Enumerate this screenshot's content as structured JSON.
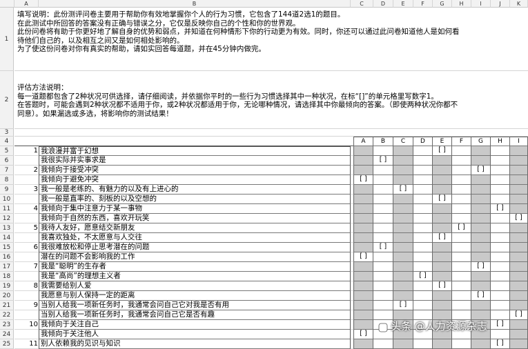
{
  "column_headers": [
    "A",
    "B",
    "C",
    "D",
    "E",
    "F",
    "G",
    "H",
    "I",
    "J",
    "K"
  ],
  "row_headers": [
    "1",
    "2",
    "3",
    "4",
    "5",
    "6",
    "7",
    "8",
    "9",
    "10",
    "11",
    "12",
    "13",
    "14",
    "15",
    "16",
    "17",
    "18",
    "19",
    "20",
    "21",
    "22",
    "23",
    "24",
    "25"
  ],
  "header_text": {
    "row1": [
      "填写说明：此份测评问卷主要用于帮助你有效地掌握你个人的行为习惯，它包含了144道2选1的题目。",
      "在此测试中所回答的答案没有正确与错误之分，它仅是反映你自己的个性和你的世界观。",
      "此份问卷将有助于你更好地了解自身的优势和弱点，并知道在何种情形下你的行动更为有效。同时，你还可以通过此问卷知道他人是如何看",
      "待他们自己的，以及相互之间又是如何相处影响的。",
      "为了使这份问卷对你有真实的帮助，请如实回答每道题，并在45分钟内做完。"
    ],
    "row2": [
      "评估方法说明：",
      "每一道题都包含了2种状况可供选择，请仔细阅读，并依据你平时的一些行为习惯选择其中一种状况，在标“[]”的单元格里写数字1。",
      "在答题时，可能会遇到2种状况都不适用于你，或2种状况都适用于你，无论哪种情况，请选择其中你最倾向的答案。（即使两种状况你都不",
      "同意）。如果漏选或多选，将影响你的测试结果！"
    ]
  },
  "answer_columns": [
    "A",
    "B",
    "C",
    "D",
    "E",
    "F",
    "G",
    "H",
    "I"
  ],
  "bracket_text": "[   ]",
  "questions": [
    {
      "row": "5",
      "num": "1",
      "text": "我浪漫并富于幻想",
      "mark": "E"
    },
    {
      "row": "6",
      "num": "",
      "text": "我很实际并实事求是",
      "mark": "B"
    },
    {
      "row": "7",
      "num": "2",
      "text": "我倾向于接受冲突",
      "mark": "G"
    },
    {
      "row": "8",
      "num": "",
      "text": "我倾向于避免冲突",
      "mark": "A"
    },
    {
      "row": "9",
      "num": "3",
      "text": "我一般是老练的、有魅力的以及有上进心的",
      "mark": "C"
    },
    {
      "row": "10",
      "num": "",
      "text": "我一般是直率的、刻板的以及空想的",
      "mark": "E"
    },
    {
      "row": "11",
      "num": "4",
      "text": "我倾向于集中注意力于某一事物",
      "mark": "H"
    },
    {
      "row": "12",
      "num": "",
      "text": "我倾向于自然的东西，喜欢开玩笑",
      "mark": "I"
    },
    {
      "row": "13",
      "num": "5",
      "text": "我待人友好，愿意结交新朋友",
      "mark": "F"
    },
    {
      "row": "14",
      "num": "",
      "text": "我喜欢独处，不太愿意与人交往",
      "mark": "E"
    },
    {
      "row": "15",
      "num": "6",
      "text": "我很难放松和停止思考潜在的问题",
      "mark": "B"
    },
    {
      "row": "16",
      "num": "",
      "text": "潜在的问题不会影响我的工作",
      "mark": "A"
    },
    {
      "row": "17",
      "num": "7",
      "text": "我是“聪明”的生存者",
      "mark": "G"
    },
    {
      "row": "18",
      "num": "",
      "text": "我是“高尚”的理想主义者",
      "mark": "D"
    },
    {
      "row": "19",
      "num": "8",
      "text": "我需要给别人爱",
      "mark": "E"
    },
    {
      "row": "20",
      "num": "",
      "text": "我愿意与别人保持一定的距离",
      "mark": "G"
    },
    {
      "row": "21",
      "num": "9",
      "text": "当别人给我一项新任务时，我通常会问自己它对我是否有用",
      "mark": "C"
    },
    {
      "row": "22",
      "num": "",
      "text": "当别人给我一项新任务时，我通常会问自己它是否有趣",
      "mark": "I"
    },
    {
      "row": "23",
      "num": "10",
      "text": "我倾向于关注自己",
      "mark": "H"
    },
    {
      "row": "24",
      "num": "",
      "text": "我倾向于关注他人",
      "mark": "A"
    },
    {
      "row": "25",
      "num": "11",
      "text": "别人依赖我的见识与知识",
      "mark": "H"
    }
  ],
  "gray_columns": [
    "A",
    "C",
    "E",
    "G",
    "I"
  ],
  "watermark": "头条 @人力资源杂志"
}
